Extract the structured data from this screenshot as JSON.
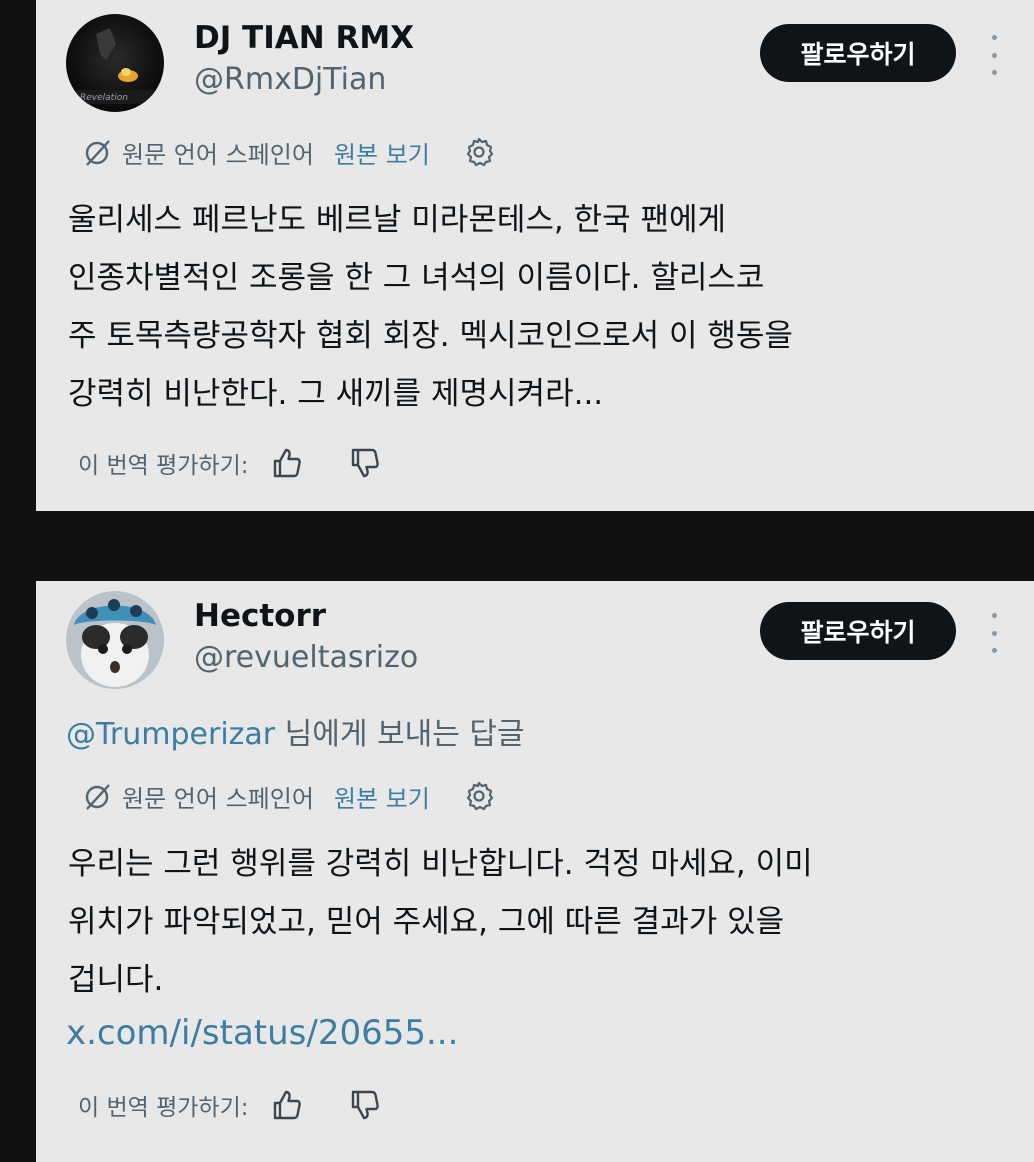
{
  "posts": [
    {
      "display_name": "DJ TIAN RMX",
      "handle": "@RmxDjTian",
      "follow_label": "팔로우하기",
      "translation": {
        "source_label": "원문 언어 스페인어",
        "show_original": "원본 보기"
      },
      "body_lines": [
        "울리세스 페르난도 베르날 미라몬테스, 한국 팬에게",
        "인종차별적인 조롱을 한 그 녀석의 이름이다. 할리스코",
        "주 토목측량공학자 협회 회장. 멕시코인으로서 이 행동을",
        "강력히 비난한다. 그 새끼를 제명시켜라..."
      ],
      "rate_label": "이 번역 평가하기:"
    },
    {
      "display_name": "Hectorr",
      "handle": "@revueltasrizo",
      "follow_label": "팔로우하기",
      "reply_to": {
        "mention": "@Trumperizar",
        "suffix": " 님에게 보내는 답글"
      },
      "translation": {
        "source_label": "원문 언어 스페인어",
        "show_original": "원본 보기"
      },
      "body_lines": [
        "우리는 그런 행위를 강력히 비난합니다. 걱정 마세요, 이미",
        "위치가 파악되었고, 믿어 주세요, 그에 따른 결과가 있을",
        "겁니다."
      ],
      "link": "x.com/i/status/20655...",
      "rate_label": "이 번역 평가하기:"
    }
  ],
  "icons": {
    "language": "no-translate-icon",
    "settings": "gear-icon",
    "more": "more-vertical-icon",
    "rate_good": "thumbs-up-icon",
    "rate_bad": "thumbs-down-icon"
  },
  "colors": {
    "background": "#111111",
    "card": "#e8e8e8",
    "text": "#0f1419",
    "secondary_text": "#536471",
    "link": "#3b7ea1",
    "follow_button": "#0f1419"
  }
}
